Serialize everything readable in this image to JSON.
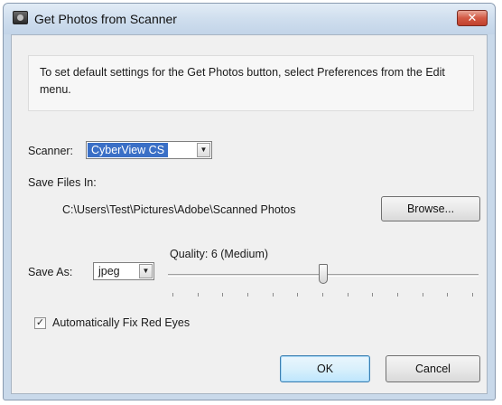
{
  "window": {
    "title": "Get Photos from Scanner",
    "close_glyph": "✕"
  },
  "info": {
    "text": "To set default settings for the Get Photos button, select Preferences from the Edit menu."
  },
  "scanner": {
    "label": "Scanner:",
    "value": "CyberView CS"
  },
  "save_files": {
    "label": "Save Files In:",
    "path": "C:\\Users\\Test\\Pictures\\Adobe\\Scanned Photos",
    "browse_label": "Browse..."
  },
  "save_as": {
    "label": "Save As:",
    "value": "jpeg"
  },
  "quality": {
    "label": "Quality: 6 (Medium)",
    "value": 6,
    "max": 12
  },
  "red_eye": {
    "label": "Automatically Fix Red Eyes",
    "checked": true,
    "check_glyph": "✓"
  },
  "buttons": {
    "ok_label": "OK",
    "cancel_label": "Cancel"
  },
  "icons": {
    "arrow_glyph": "▼"
  }
}
